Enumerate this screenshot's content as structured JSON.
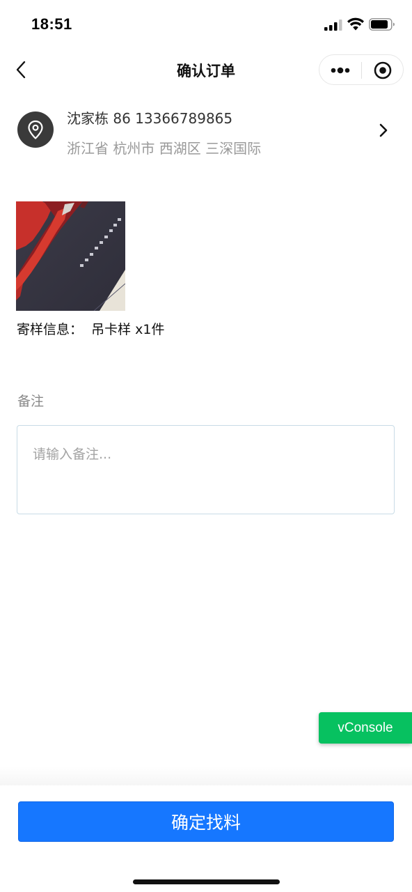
{
  "status_bar": {
    "time": "18:51"
  },
  "nav": {
    "title": "确认订单"
  },
  "address": {
    "name_phone": "沈家栋 86 13366789865",
    "detail": "浙江省 杭州市 西湖区 三深国际"
  },
  "product": {
    "sample_info": "寄样信息：  吊卡样 x1件"
  },
  "remark": {
    "label": "备注",
    "value": "",
    "placeholder": "请输入备注..."
  },
  "vconsole": {
    "label": "vConsole",
    "color": "#07c160"
  },
  "footer": {
    "confirm_label": "确定找料",
    "confirm_color": "#1677ff"
  },
  "icons": [
    "signal-icon",
    "wifi-icon",
    "battery-icon",
    "back-arrow-icon",
    "more-dots-icon",
    "target-icon",
    "location-pin-icon",
    "chevron-right-icon"
  ]
}
